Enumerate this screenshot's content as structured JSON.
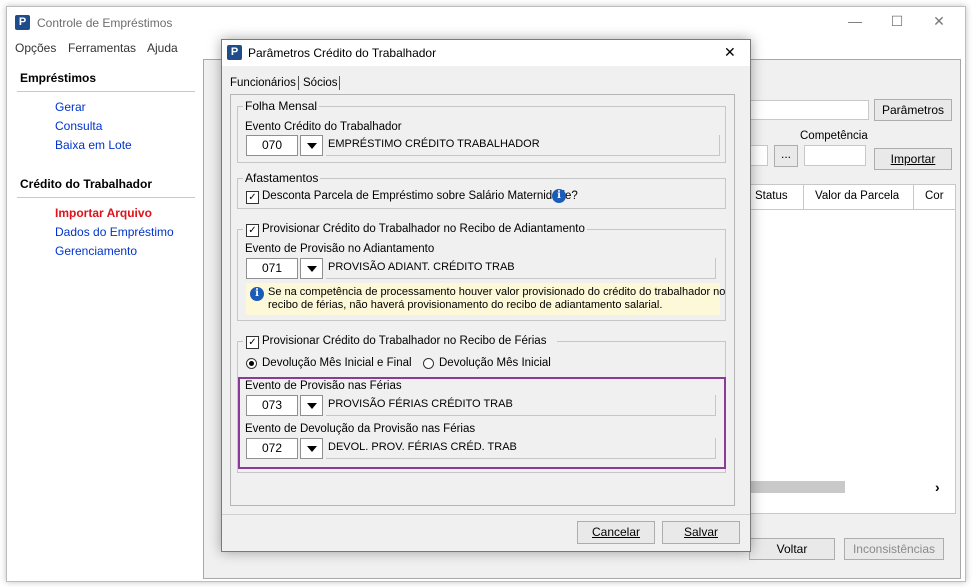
{
  "main_window": {
    "title": "Controle de Empréstimos",
    "menu": [
      "Opções",
      "Ferramentas",
      "Ajuda"
    ],
    "controls": {
      "minimize": "—",
      "maximize": "☐",
      "close": "✕"
    }
  },
  "sidebar": {
    "sections": [
      {
        "heading": "Empréstimos",
        "items": [
          "Gerar",
          "Consulta",
          "Baixa em Lote"
        ]
      },
      {
        "heading": "Crédito do Trabalhador",
        "items": [
          "Importar Arquivo",
          "Dados do Empréstimo",
          "Gerenciamento"
        ]
      }
    ]
  },
  "background_panel": {
    "parametros_button": "Parâmetros",
    "competencia_label": "Competência",
    "browse_button": "...",
    "importar_button": "Importar",
    "table_headers": [
      "Status",
      "Valor da Parcela",
      "Cor"
    ],
    "scroll_arrow": "›",
    "voltar_button": "Voltar",
    "inconsistencias_button": "Inconsistências"
  },
  "dialog": {
    "title": "Parâmetros Crédito do Trabalhador",
    "close": "✕",
    "tabs": [
      "Funcionários",
      "Sócios"
    ],
    "folha_mensal": {
      "group_label": "Folha Mensal",
      "field_label": "Evento Crédito do Trabalhador",
      "code": "070",
      "description": "EMPRÉSTIMO CRÉDITO TRABALHADOR"
    },
    "afastamentos": {
      "group_label": "Afastamentos",
      "checkbox_label": "Desconta Parcela de Empréstimo sobre Salário Maternidade?",
      "checked": true
    },
    "adiantamento": {
      "group_label": "Provisionar Crédito do Trabalhador no Recibo de Adiantamento",
      "checked": true,
      "field_label": "Evento de Provisão no Adiantamento",
      "code": "071",
      "description": "PROVISÃO ADIANT. CRÉDITO TRAB",
      "info_line1": "Se na competência de processamento houver valor provisionado do crédito do trabalhador no",
      "info_line2": "recibo de férias, não haverá provisionamento do recibo de adiantamento salarial."
    },
    "ferias": {
      "group_label": "Provisionar Crédito do Trabalhador no Recibo de Férias",
      "checked": true,
      "radio1": "Devolução Mês Inicial e Final",
      "radio2": "Devolução Mês Inicial",
      "provisao_label": "Evento de Provisão nas Férias",
      "provisao_code": "073",
      "provisao_description": "PROVISÃO FÉRIAS CRÉDITO TRAB",
      "devolucao_label": "Evento de Devolução da Provisão nas Férias",
      "devolucao_code": "072",
      "devolucao_description": "DEVOL. PROV. FÉRIAS CRÉD. TRAB"
    },
    "buttons": {
      "cancel": "Cancelar",
      "save": "Salvar"
    }
  },
  "colors": {
    "highlight": "#8b3a9a",
    "info_bg": "#fdf8d8",
    "link": "#0033cc",
    "active_link": "#e0121a"
  },
  "icons": {
    "app": "app-logo-icon",
    "info": "info-icon"
  }
}
